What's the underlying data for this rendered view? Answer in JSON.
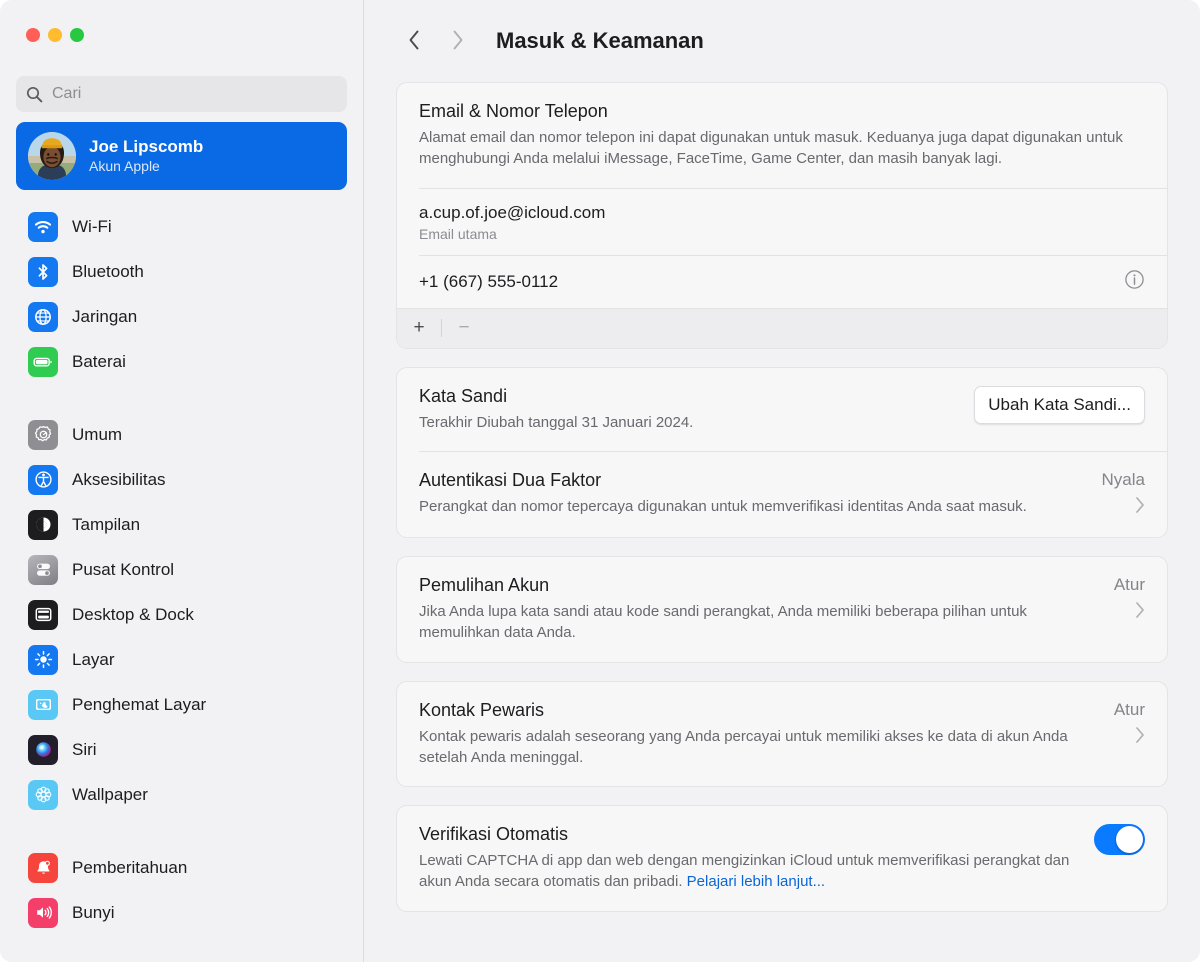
{
  "window": {
    "traffic_lights": [
      {
        "name": "close",
        "color": "#ff5f57"
      },
      {
        "name": "minimize",
        "color": "#febc2e"
      },
      {
        "name": "zoom",
        "color": "#28c840"
      }
    ]
  },
  "sidebar": {
    "search": {
      "placeholder": "Cari",
      "value": "",
      "icon": "search-icon"
    },
    "account": {
      "name": "Joe Lipscomb",
      "subtitle": "Akun Apple",
      "avatar": "user-avatar",
      "selected": true
    },
    "groups": [
      {
        "items": [
          {
            "label": "Wi-Fi",
            "icon": "wifi-icon",
            "color": "#1478f0"
          },
          {
            "label": "Bluetooth",
            "icon": "bluetooth-icon",
            "color": "#1478f0"
          },
          {
            "label": "Jaringan",
            "icon": "globe-icon",
            "color": "#1478f0"
          },
          {
            "label": "Baterai",
            "icon": "battery-icon",
            "color": "#30cc51"
          }
        ]
      },
      {
        "items": [
          {
            "label": "Umum",
            "icon": "gear-icon",
            "color": "#8e8e93"
          },
          {
            "label": "Aksesibilitas",
            "icon": "accessibility-icon",
            "color": "#1478f0"
          },
          {
            "label": "Tampilan",
            "icon": "appearance-icon",
            "color": "#1d1d1f"
          },
          {
            "label": "Pusat Kontrol",
            "icon": "control-center-icon",
            "color": "#8e8e93"
          },
          {
            "label": "Desktop & Dock",
            "icon": "desktop-dock-icon",
            "color": "#1d1d1f"
          },
          {
            "label": "Layar",
            "icon": "display-icon",
            "color": "#1478f0"
          },
          {
            "label": "Penghemat Layar",
            "icon": "screensaver-icon",
            "color": "#5ac8f5"
          },
          {
            "label": "Siri",
            "icon": "siri-icon",
            "color": "#2a2a35"
          },
          {
            "label": "Wallpaper",
            "icon": "wallpaper-icon",
            "color": "#5ac8f5"
          }
        ]
      },
      {
        "items": [
          {
            "label": "Pemberitahuan",
            "icon": "notifications-icon",
            "color": "#f6453c"
          },
          {
            "label": "Bunyi",
            "icon": "sound-icon",
            "color": "#f43f6b"
          }
        ]
      }
    ]
  },
  "header": {
    "back_icon": "chevron-left-icon",
    "forward_icon": "chevron-right-icon",
    "title": "Masuk & Keamanan"
  },
  "cards": {
    "email_phone": {
      "title": "Email & Nomor Telepon",
      "description": "Alamat email dan nomor telepon ini dapat digunakan untuk masuk. Keduanya juga dapat digunakan untuk menghubungi Anda melalui iMessage, FaceTime, Game Center, dan masih banyak lagi.",
      "rows": [
        {
          "value": "a.cup.of.joe@icloud.com",
          "sub": "Email utama",
          "info": false
        },
        {
          "value": "+1 (667) 555-0112",
          "sub": "",
          "info": true,
          "info_icon": "info-circle-icon"
        }
      ],
      "footer": {
        "add_label": "+",
        "remove_label": "−"
      }
    },
    "password": {
      "title": "Kata Sandi",
      "description": "Terakhir Diubah tanggal 31 Januari 2024.",
      "button_label": "Ubah Kata Sandi..."
    },
    "two_factor": {
      "title": "Autentikasi Dua Faktor",
      "description": "Perangkat dan nomor tepercaya digunakan untuk memverifikasi identitas Anda saat masuk.",
      "status": "Nyala",
      "chevron": "chevron-right-icon"
    },
    "account_recovery": {
      "title": "Pemulihan Akun",
      "description": "Jika Anda lupa kata sandi atau kode sandi perangkat, Anda memiliki beberapa pilihan untuk memulihkan data Anda.",
      "status": "Atur",
      "chevron": "chevron-right-icon"
    },
    "legacy_contact": {
      "title": "Kontak Pewaris",
      "description": "Kontak pewaris adalah seseorang yang Anda percayai untuk memiliki akses ke data di akun Anda setelah Anda meninggal.",
      "status": "Atur",
      "chevron": "chevron-right-icon"
    },
    "automatic_verification": {
      "title": "Verifikasi Otomatis",
      "description_part1": "Lewati CAPTCHA di app dan web dengan mengizinkan iCloud untuk memverifikasi perangkat dan akun Anda secara otomatis dan pribadi. ",
      "link_label": "Pelajari lebih lanjut...",
      "toggle_on": true
    }
  },
  "colors": {
    "accent_blue": "#0a69e4",
    "toggle_blue": "#0a7aff",
    "link_blue": "#0a66d8",
    "sidebar_bg": "#f2f2f4",
    "card_bg": "#f7f7f8"
  }
}
